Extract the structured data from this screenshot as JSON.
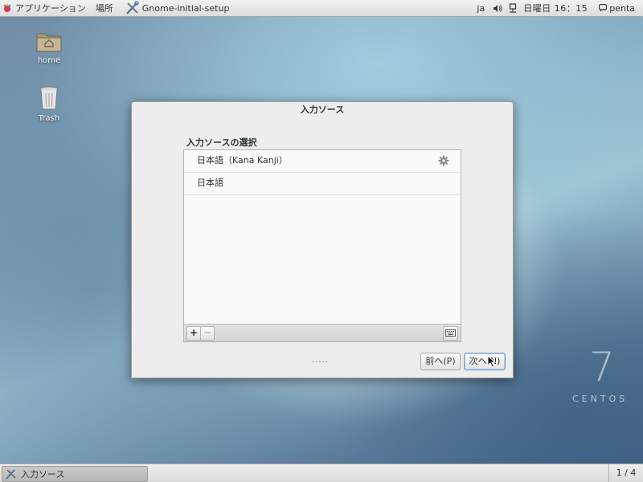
{
  "top_panel": {
    "applications_label": "アプリケーション",
    "places_label": "場所",
    "window_label": "Gnome-initial-setup",
    "language_indicator": "ja",
    "clock": "日曜日 16：15",
    "user": "penta"
  },
  "desktop": {
    "icons": [
      {
        "label": "home",
        "icon": "folder-home-icon"
      },
      {
        "label": "Trash",
        "icon": "trash-icon"
      }
    ],
    "watermark_number": "7",
    "watermark_text": "CENTOS"
  },
  "dialog": {
    "title": "入力ソース",
    "section_label": "入力ソースの選択",
    "sources": [
      {
        "label": "日本語（Kana Kanji）",
        "has_settings": true
      },
      {
        "label": "日本語",
        "has_settings": false
      }
    ],
    "add_label": "+",
    "remove_label": "−",
    "page_dots": ".....",
    "prev_label": "前へ(P)",
    "next_label": "次へ(N)"
  },
  "bottom_panel": {
    "task_label": "入力ソース",
    "workspace": "1 / 4"
  }
}
